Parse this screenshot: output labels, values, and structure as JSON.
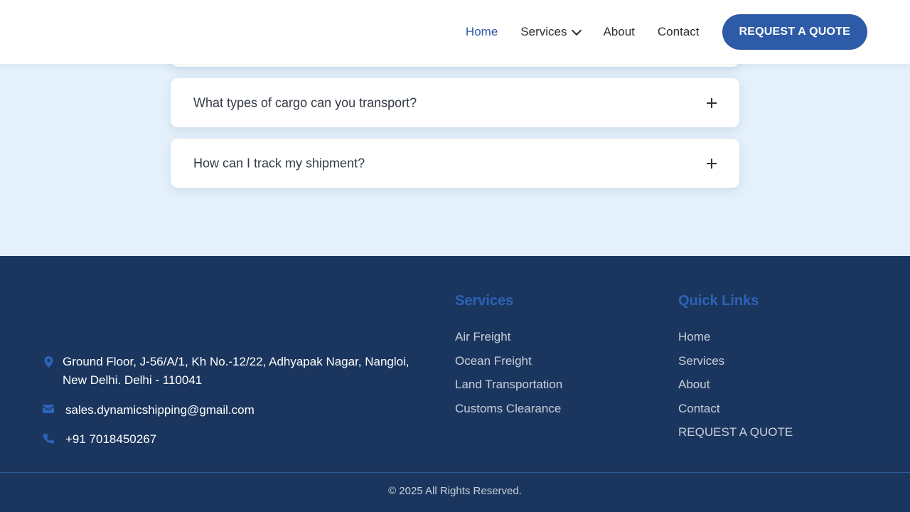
{
  "nav": {
    "items": [
      {
        "label": "Home",
        "active": true
      },
      {
        "label": "Services",
        "active": false,
        "has_dropdown": true
      },
      {
        "label": "About",
        "active": false
      },
      {
        "label": "Contact",
        "active": false
      }
    ],
    "cta_label": "REQUEST A QUOTE"
  },
  "faq": {
    "items": [
      {
        "question": "What types of cargo can you transport?",
        "expanded": false
      },
      {
        "question": "How can I track my shipment?",
        "expanded": false
      }
    ]
  },
  "footer": {
    "address": "Ground Floor, J-56/A/1, Kh No.-12/22, Adhyapak Nagar, Nangloi, New Delhi. Delhi - 110041",
    "email": "sales.dynamicshipping@gmail.com",
    "phone": "+91 7018450267",
    "services_title": "Services",
    "services": [
      "Air Freight",
      "Ocean Freight",
      "Land Transportation",
      "Customs Clearance"
    ],
    "quick_links_title": "Quick Links",
    "quick_links": [
      "Home",
      "Services",
      "About",
      "Contact",
      "REQUEST A QUOTE"
    ],
    "copyright": "© 2025 All Rights Reserved."
  },
  "colors": {
    "primary": "#2d5ba7",
    "footer_bg": "#1b365e",
    "page_bg": "#e4f1fc",
    "heading_accent": "#2d63b8"
  },
  "icons": {
    "address": "map-marker-icon",
    "email": "envelope-icon",
    "phone": "phone-icon",
    "faq_toggle": "plus-icon",
    "dropdown": "chevron-down-icon"
  }
}
